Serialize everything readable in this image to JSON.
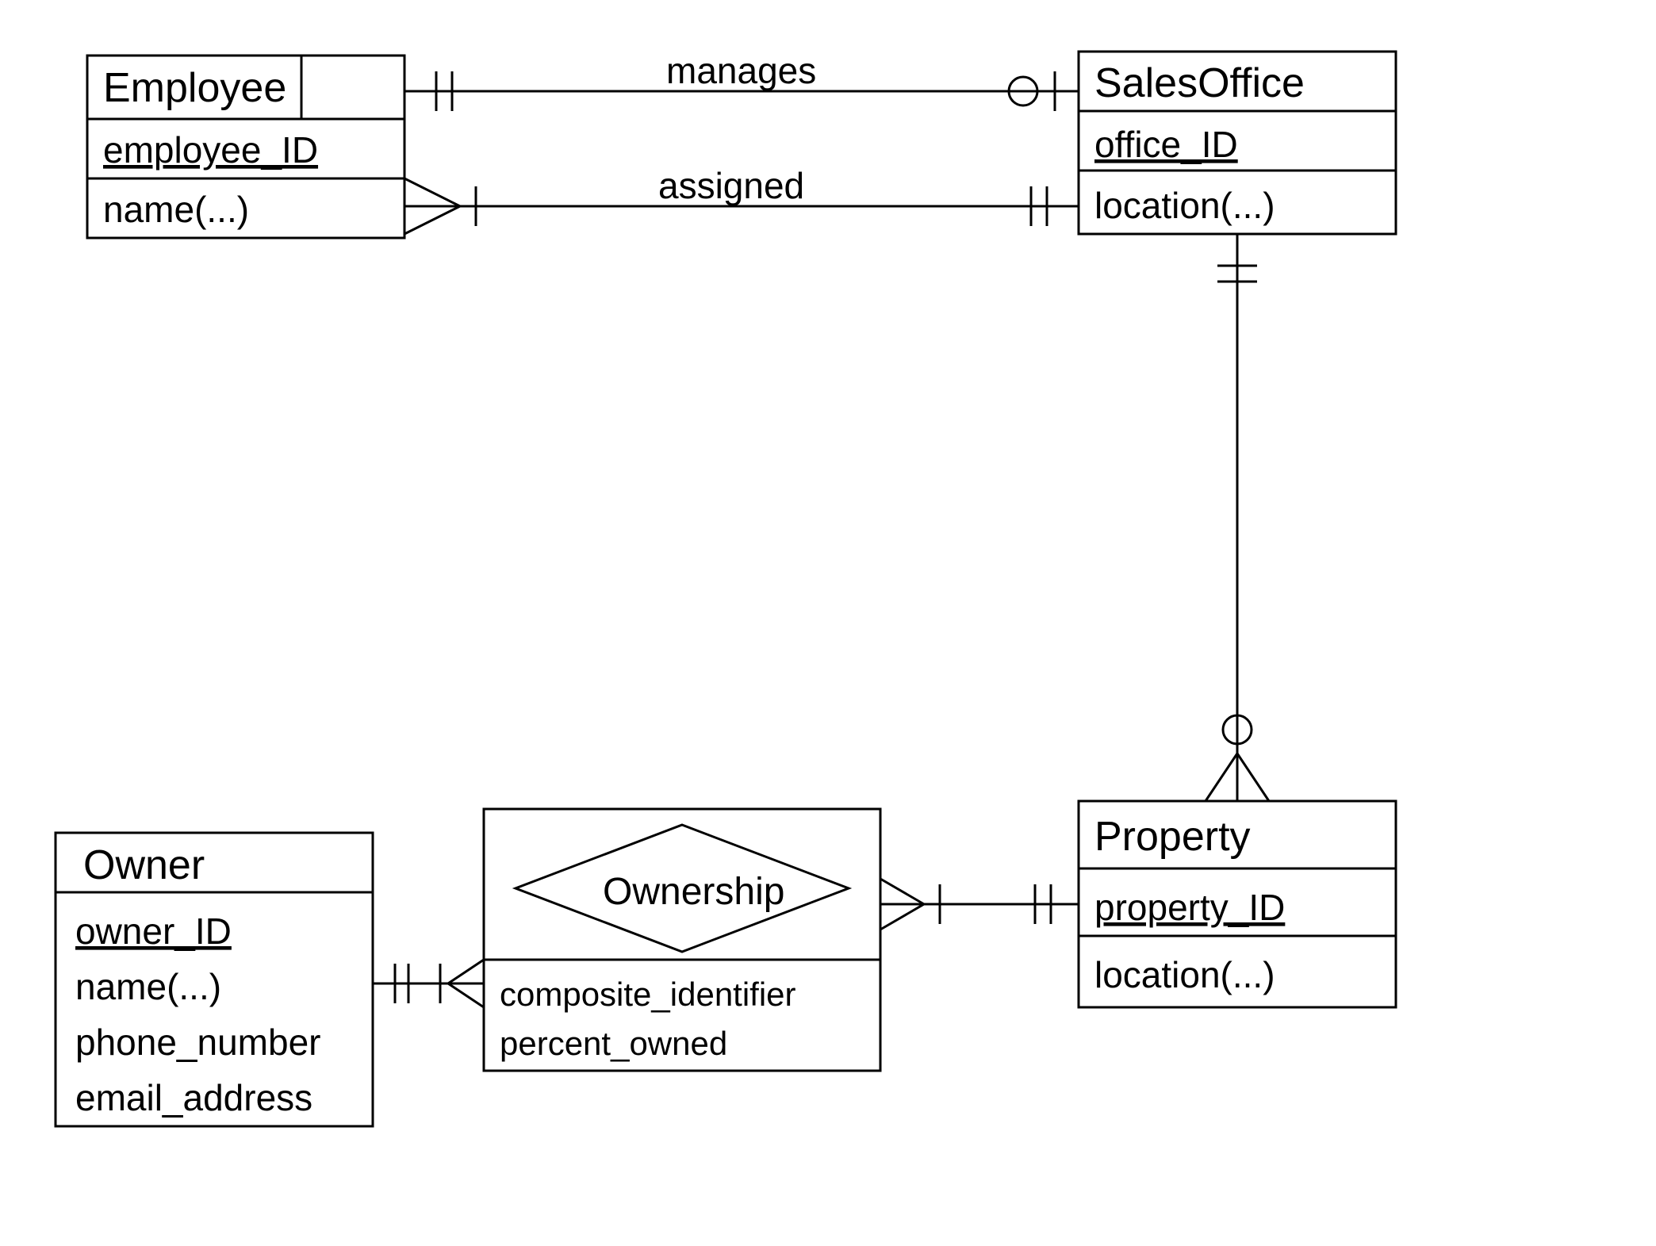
{
  "entities": {
    "employee": {
      "name": "Employee",
      "attributes": [
        "employee_ID",
        "name(...)"
      ],
      "primaryKeyIndex": 0
    },
    "salesOffice": {
      "name": "SalesOffice",
      "attributes": [
        "office_ID",
        "location(...)"
      ],
      "primaryKeyIndex": 0
    },
    "owner": {
      "name": "Owner",
      "attributes": [
        "owner_ID",
        "name(...)",
        "phone_number",
        "email_address"
      ],
      "primaryKeyIndex": 0
    },
    "ownership": {
      "name": "Ownership",
      "attributes": [
        "composite_identifier",
        "percent_owned"
      ],
      "associative": true
    },
    "property": {
      "name": "Property",
      "attributes": [
        "property_ID",
        "location(...)"
      ],
      "primaryKeyIndex": 0
    }
  },
  "relationships": {
    "manages": {
      "label": "manages",
      "from": "Employee",
      "to": "SalesOffice",
      "fromCard": "one-and-only-one",
      "toCard": "zero-or-one"
    },
    "assigned": {
      "label": "assigned",
      "from": "Employee",
      "to": "SalesOffice",
      "fromCard": "one-or-many",
      "toCard": "one-and-only-one"
    },
    "salesOfficeProperty": {
      "from": "SalesOffice",
      "to": "Property",
      "fromCard": "one-and-only-one",
      "toCard": "zero-or-many"
    },
    "ownerOwnership": {
      "from": "Owner",
      "to": "Ownership",
      "fromCard": "one-and-only-one",
      "toCard": "one-or-many"
    },
    "ownershipProperty": {
      "from": "Ownership",
      "to": "Property",
      "fromCard": "one-or-many",
      "toCard": "one-and-only-one"
    }
  }
}
